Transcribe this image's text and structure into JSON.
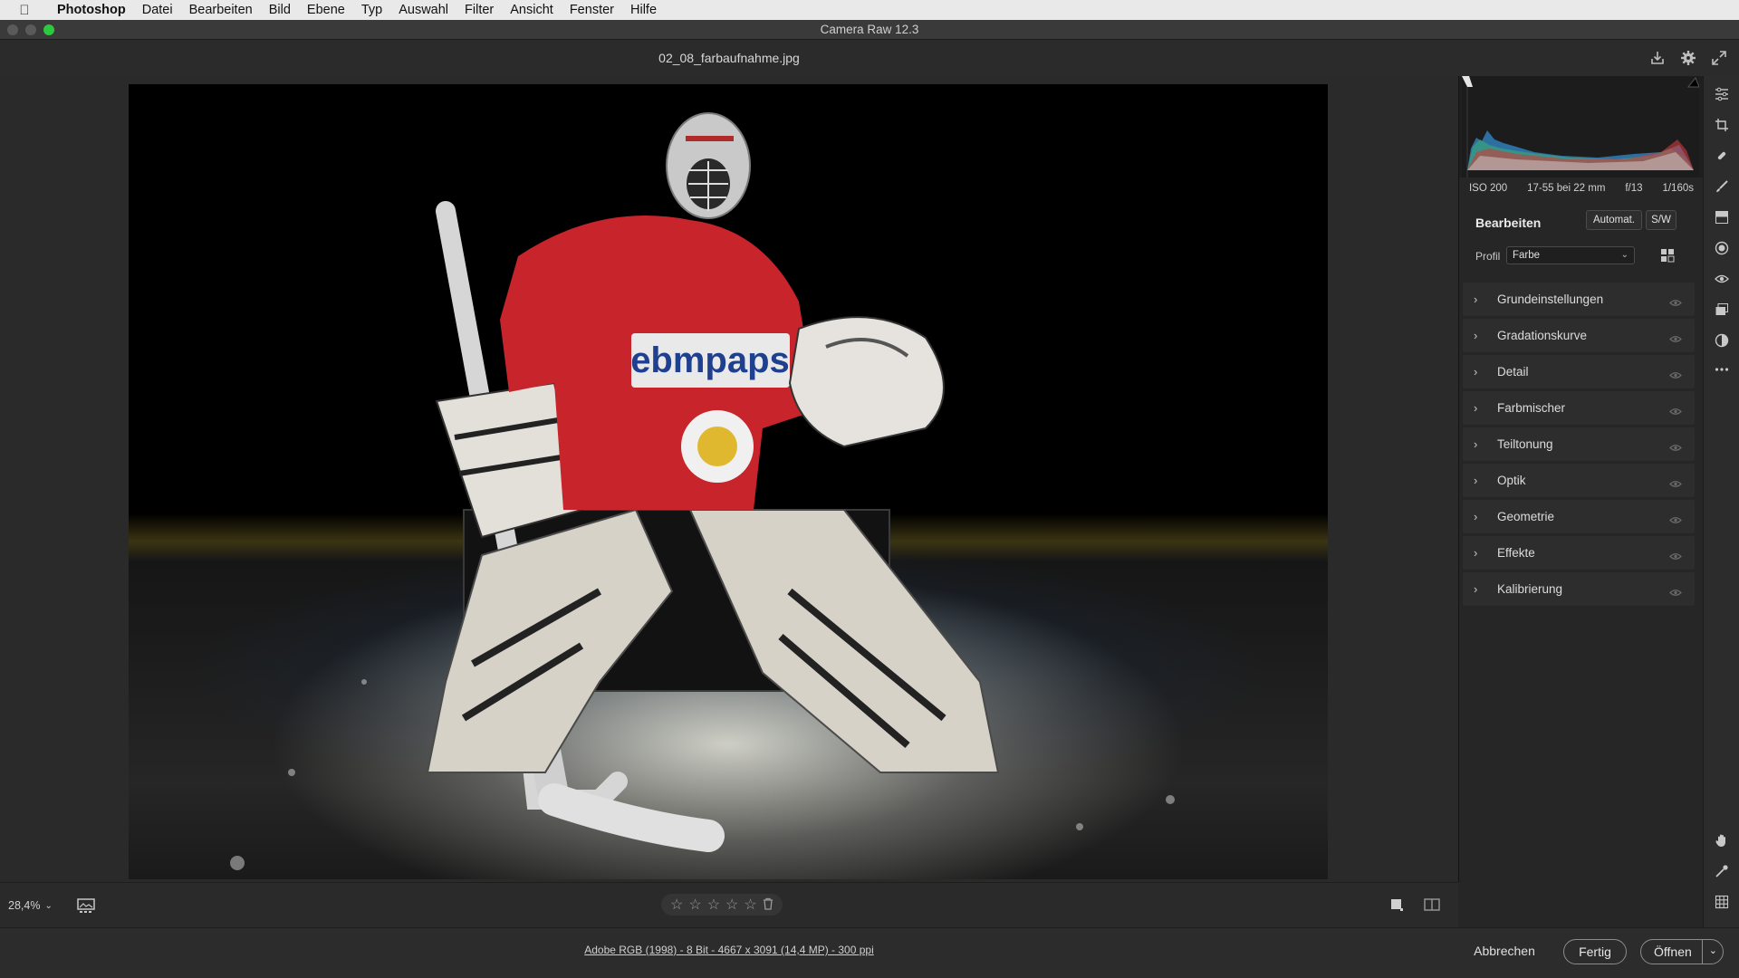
{
  "menubar": {
    "app": "Photoshop",
    "items": [
      "Datei",
      "Bearbeiten",
      "Bild",
      "Ebene",
      "Typ",
      "Auswahl",
      "Filter",
      "Ansicht",
      "Fenster",
      "Hilfe"
    ]
  },
  "window": {
    "title": "Camera Raw 12.3"
  },
  "header": {
    "filename": "02_08_farbaufnahme.jpg"
  },
  "histogram": {
    "exif": {
      "iso": "ISO 200",
      "lens": "17-55 bei 22 mm",
      "aperture": "f/13",
      "shutter": "1/160s"
    }
  },
  "edit_panel": {
    "title": "Bearbeiten",
    "auto_label": "Automat.",
    "bw_label": "S/W",
    "profile_label": "Profil",
    "profile_value": "Farbe",
    "sections": [
      {
        "label": "Grundeinstellungen"
      },
      {
        "label": "Gradationskurve"
      },
      {
        "label": "Detail"
      },
      {
        "label": "Farbmischer"
      },
      {
        "label": "Teiltonung"
      },
      {
        "label": "Optik"
      },
      {
        "label": "Geometrie"
      },
      {
        "label": "Effekte"
      },
      {
        "label": "Kalibrierung"
      }
    ]
  },
  "bottombar": {
    "zoom": "28,4%"
  },
  "footer": {
    "image_info": "Adobe RGB (1998) - 8 Bit - 4667 x 3091 (14,4 MP) - 300 ppi",
    "cancel_label": "Abbrechen",
    "done_label": "Fertig",
    "open_label": "Öffnen"
  },
  "colors": {
    "panel_bg": "#262626",
    "section_bg": "#2d2d2d",
    "jersey_red": "#c8242b",
    "traffic_close": "#5a5a5a",
    "traffic_max": "#2bc840"
  }
}
